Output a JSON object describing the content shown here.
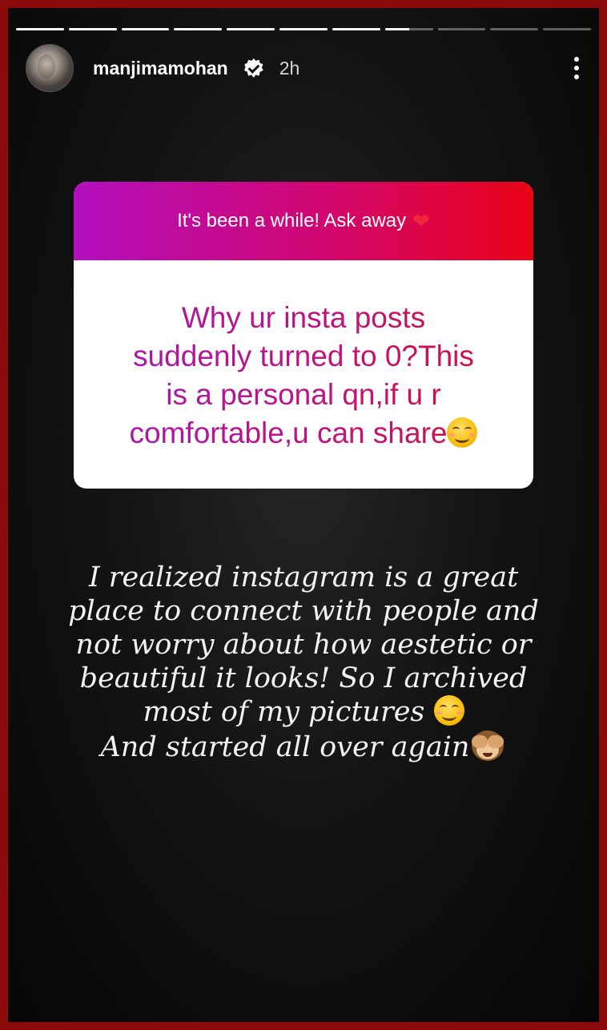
{
  "story": {
    "progress": {
      "total_segments": 11,
      "current_segment": 8,
      "current_segment_fraction": 0.5
    },
    "header": {
      "username": "manjimamohan",
      "verified": true,
      "timestamp": "2h",
      "more_icon": "more-vertical-icon"
    },
    "question_box": {
      "prompt": "It's been a while! Ask away",
      "prompt_emoji": "heart",
      "question_lines": [
        "Why ur insta posts",
        "suddenly turned to 0?This",
        "is a personal qn,if u r",
        "comfortable,u can share"
      ],
      "question_emoji": "smiling-face"
    },
    "answer": {
      "lines": [
        "I realized instagram is a great",
        "place to connect with people and",
        "not worry about how aestetic or",
        "beautiful it looks! So I archived",
        "most of my pictures ",
        "And started all over again"
      ],
      "line5_emoji": "smiling-face",
      "line6_emoji": "see-no-evil-monkey"
    },
    "colors": {
      "gradient_start": "#b30fbf",
      "gradient_end": "#ea0416",
      "frame": "#8b0a0a"
    }
  }
}
